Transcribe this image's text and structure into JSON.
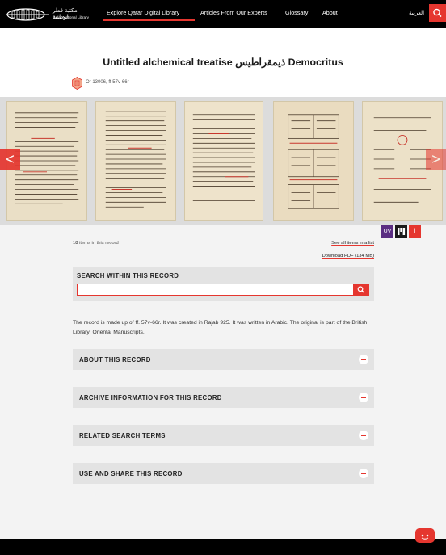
{
  "header": {
    "logo_arabic": "مكتبة قطر الوطنية",
    "logo_english": "Qatar National Library",
    "nav": [
      {
        "label": "Explore Qatar Digital Library"
      },
      {
        "label": "Articles From Our Experts"
      },
      {
        "label": "Glossary"
      },
      {
        "label": "About"
      }
    ],
    "language_link": "العربية"
  },
  "record": {
    "title": "Untitled alchemical treatise ذيمقراطيس Democritus",
    "shelfmark": "Or 13006, ff 57v-66r"
  },
  "carousel": {
    "prev_label": "<",
    "next_label": ">"
  },
  "viewer_buttons": [
    {
      "label": "UV",
      "color": "#5a2d82"
    },
    {
      "label": "M",
      "color": "#1a1a1a"
    },
    {
      "label": "i",
      "color": "#e5362f"
    }
  ],
  "items": {
    "count": "18",
    "count_suffix": " items in this record",
    "see_all": "See all items in a list",
    "download": "Download PDF (134 MB)"
  },
  "search": {
    "title": "SEARCH WITHIN THIS RECORD",
    "value": ""
  },
  "description": "The record is made up of ff. 57v-66r. It was created in Rajab 925. It was written in Arabic. The original is part of the British Library: Oriental Manuscripts.",
  "sections": [
    {
      "label": "ABOUT THIS RECORD"
    },
    {
      "label": "ARCHIVE INFORMATION FOR THIS RECORD"
    },
    {
      "label": "RELATED SEARCH TERMS"
    },
    {
      "label": "USE AND SHARE THIS RECORD"
    }
  ],
  "colors": {
    "accent": "#e5362f",
    "header": "#000000"
  }
}
